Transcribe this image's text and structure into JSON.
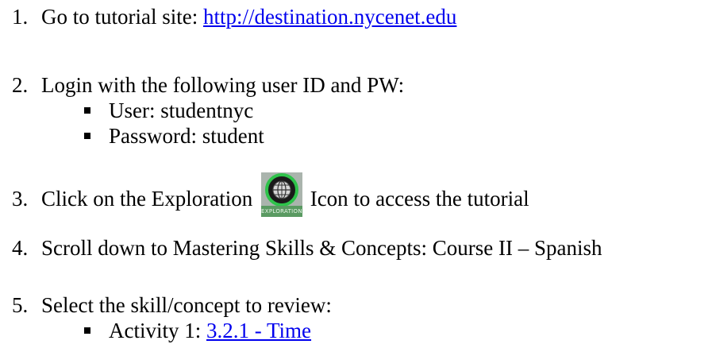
{
  "steps": [
    {
      "number": "1.",
      "text": "Go to tutorial site: ",
      "link": "http://destination.nycenet.edu"
    },
    {
      "number": "2.",
      "text": "Login with the following user ID and PW:",
      "bullets": [
        "User: studentnyc",
        "Password: student"
      ]
    },
    {
      "number": "3.",
      "text_before": "Click on the Exploration",
      "text_after": "Icon to access the tutorial",
      "icon": "exploration-globe-icon",
      "icon_caption": "EXPLORATION"
    },
    {
      "number": "4.",
      "text": "Scroll down to Mastering Skills & Concepts: Course II – Spanish"
    },
    {
      "number": "5.",
      "text": "Select the skill/concept to review:",
      "bullets": [
        {
          "prefix": "Activity 1: ",
          "link": "3.2.1 - Time"
        }
      ]
    }
  ],
  "colors": {
    "text": "#000000",
    "link": "#0000ee",
    "icon_ring": "#2ec34a",
    "icon_caption_bg": "#5a9a62"
  }
}
